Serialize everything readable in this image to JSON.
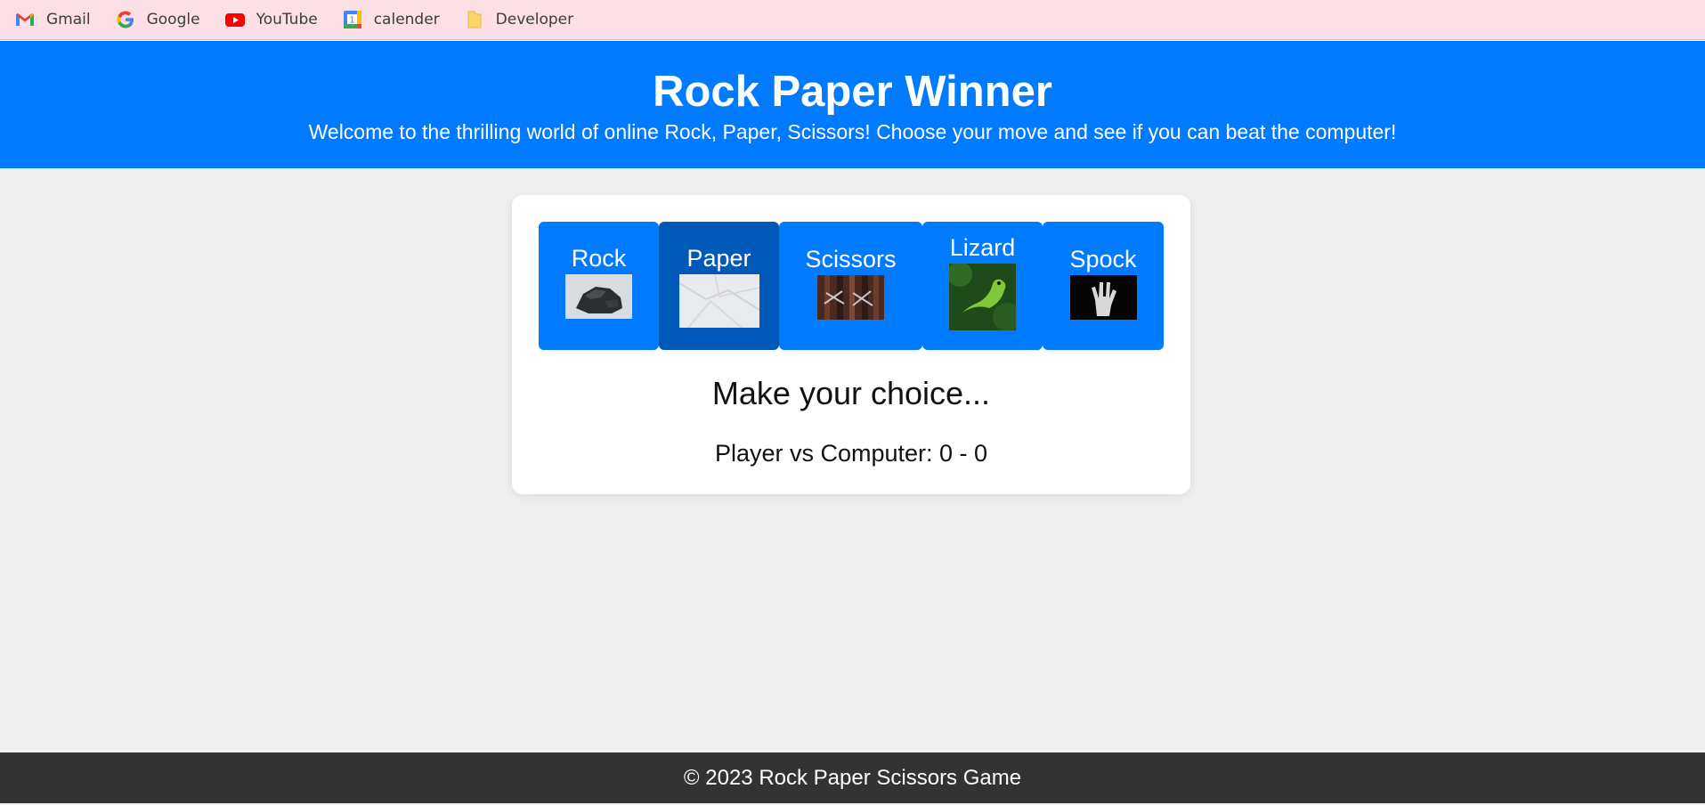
{
  "bookmarks": [
    {
      "label": "Gmail",
      "icon": "gmail-icon"
    },
    {
      "label": "Google",
      "icon": "google-icon"
    },
    {
      "label": "YouTube",
      "icon": "youtube-icon"
    },
    {
      "label": "calender",
      "icon": "calendar-icon"
    },
    {
      "label": "Developer",
      "icon": "folder-icon"
    }
  ],
  "header": {
    "title": "Rock Paper Winner",
    "subtitle": "Welcome to the thrilling world of online Rock, Paper, Scissors! Choose your move and see if you can beat the computer!"
  },
  "game": {
    "choices": [
      {
        "label": "Rock",
        "image": "rock-image",
        "selected": false
      },
      {
        "label": "Paper",
        "image": "paper-image",
        "selected": true
      },
      {
        "label": "Scissors",
        "image": "scissors-image",
        "selected": false
      },
      {
        "label": "Lizard",
        "image": "lizard-image",
        "selected": false
      },
      {
        "label": "Spock",
        "image": "spock-hand-image",
        "selected": false
      }
    ],
    "result": "Make your choice...",
    "score": "Player vs Computer: 0 - 0"
  },
  "footer": {
    "text": "© 2023 Rock Paper Scissors Game"
  },
  "colors": {
    "header_bg": "#007bff",
    "button_bg": "#007bff",
    "button_selected_bg": "#0059b8",
    "footer_bg": "#333333",
    "bookmarks_bg": "#fde0e6"
  }
}
